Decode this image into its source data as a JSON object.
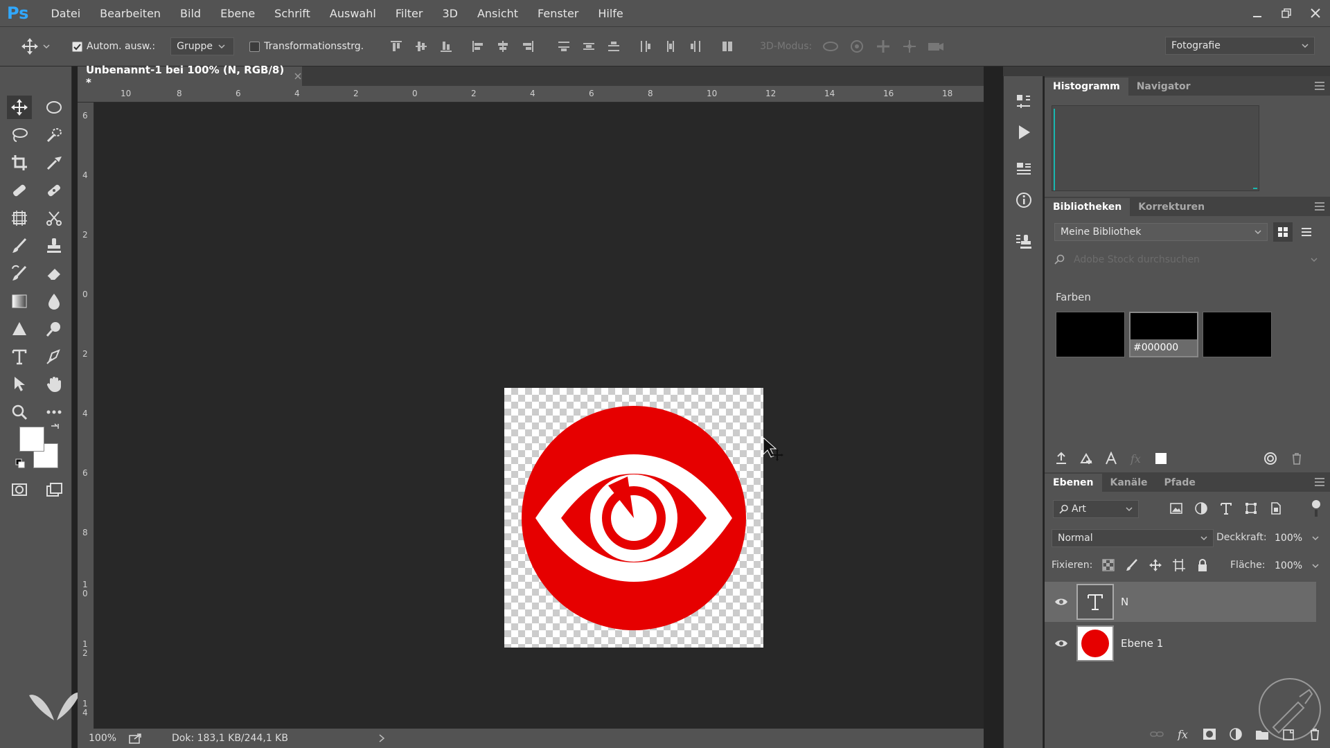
{
  "app": {
    "logo": "Ps"
  },
  "menu": [
    "Datei",
    "Bearbeiten",
    "Bild",
    "Ebene",
    "Schrift",
    "Auswahl",
    "Filter",
    "3D",
    "Ansicht",
    "Fenster",
    "Hilfe"
  ],
  "options": {
    "auto_select_label": "Autom. ausw.:",
    "auto_select_checked": true,
    "auto_select_value": "Gruppe",
    "transform_label": "Transformationsstrg.",
    "mode_3d": "3D-Modus:",
    "workspace": "Fotografie"
  },
  "document": {
    "tab_title": "Unbenannt-1 bei 100% (N, RGB/8) *",
    "ruler_top": [
      "10",
      "8",
      "6",
      "4",
      "2",
      "0",
      "2",
      "4",
      "6",
      "8",
      "10",
      "12",
      "14",
      "16",
      "18"
    ],
    "ruler_left": [
      "6",
      "4",
      "2",
      "0",
      "2",
      "4",
      "6",
      "8",
      "1 0",
      "1 2",
      "1 4"
    ]
  },
  "status": {
    "zoom": "100%",
    "doc_size": "Dok: 183,1 KB/244,1 KB"
  },
  "panels": {
    "top_tabs": [
      "Histogramm",
      "Navigator"
    ],
    "lib_tabs": [
      "Bibliotheken",
      "Korrekturen"
    ],
    "library_name": "Meine Bibliothek",
    "search_placeholder": "Adobe Stock durchsuchen",
    "colors_heading": "Farben",
    "swatch_label": "#000000",
    "layer_tabs": [
      "Ebenen",
      "Kanäle",
      "Pfade"
    ],
    "filter_value": "Art",
    "blend_mode": "Normal",
    "opacity_label": "Deckkraft:",
    "opacity_value": "100%",
    "lock_label": "Fixieren:",
    "fill_label": "Fläche:",
    "fill_value": "100%",
    "layers": [
      {
        "name": "N",
        "type": "text"
      },
      {
        "name": "Ebene 1",
        "type": "pixel"
      }
    ]
  },
  "colors": {
    "accent_red": "#e60000",
    "ps_blue": "#31a8ff"
  }
}
